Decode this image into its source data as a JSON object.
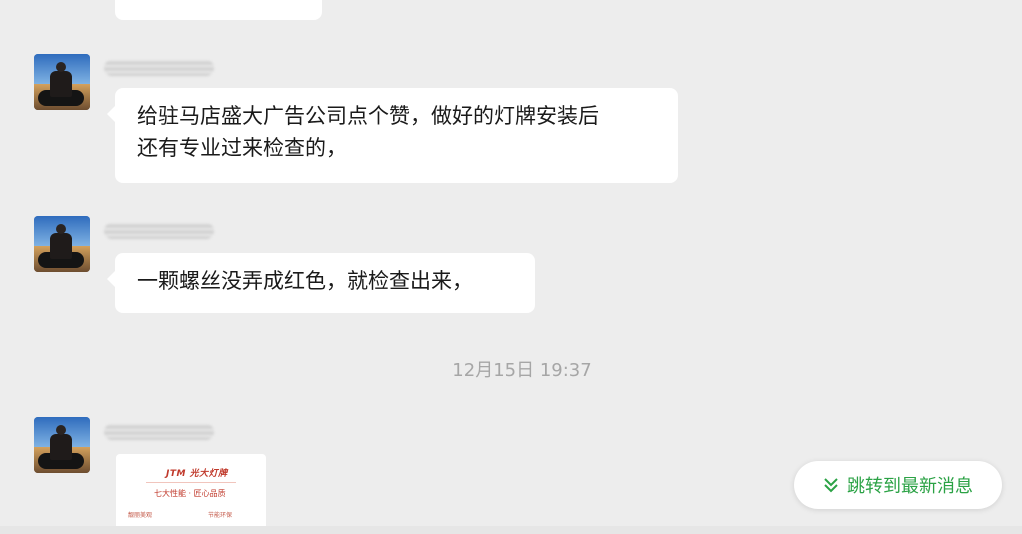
{
  "chat": {
    "messages": [
      {
        "lines": [
          "给驻马店盛大广告公司点个赞，做好的灯牌安装后",
          "还有专业过来检查的，"
        ]
      },
      {
        "lines": [
          "一颗螺丝没弄成红色，就检查出来，"
        ]
      }
    ],
    "timestamp": "12月15日 19:37",
    "image_message": {
      "logo_text": "JTM 光大灯牌",
      "headline": "七大性能 · 匠心品质",
      "left_caption": "靓丽美观",
      "right_caption": "节能环保"
    }
  },
  "jump_button": {
    "label": "跳转到最新消息",
    "icon": "double-chevron-down-icon",
    "color": "#2ba245"
  },
  "colors": {
    "background": "#ededed",
    "bubble": "#ffffff",
    "timestamp": "#a6a6a6"
  }
}
